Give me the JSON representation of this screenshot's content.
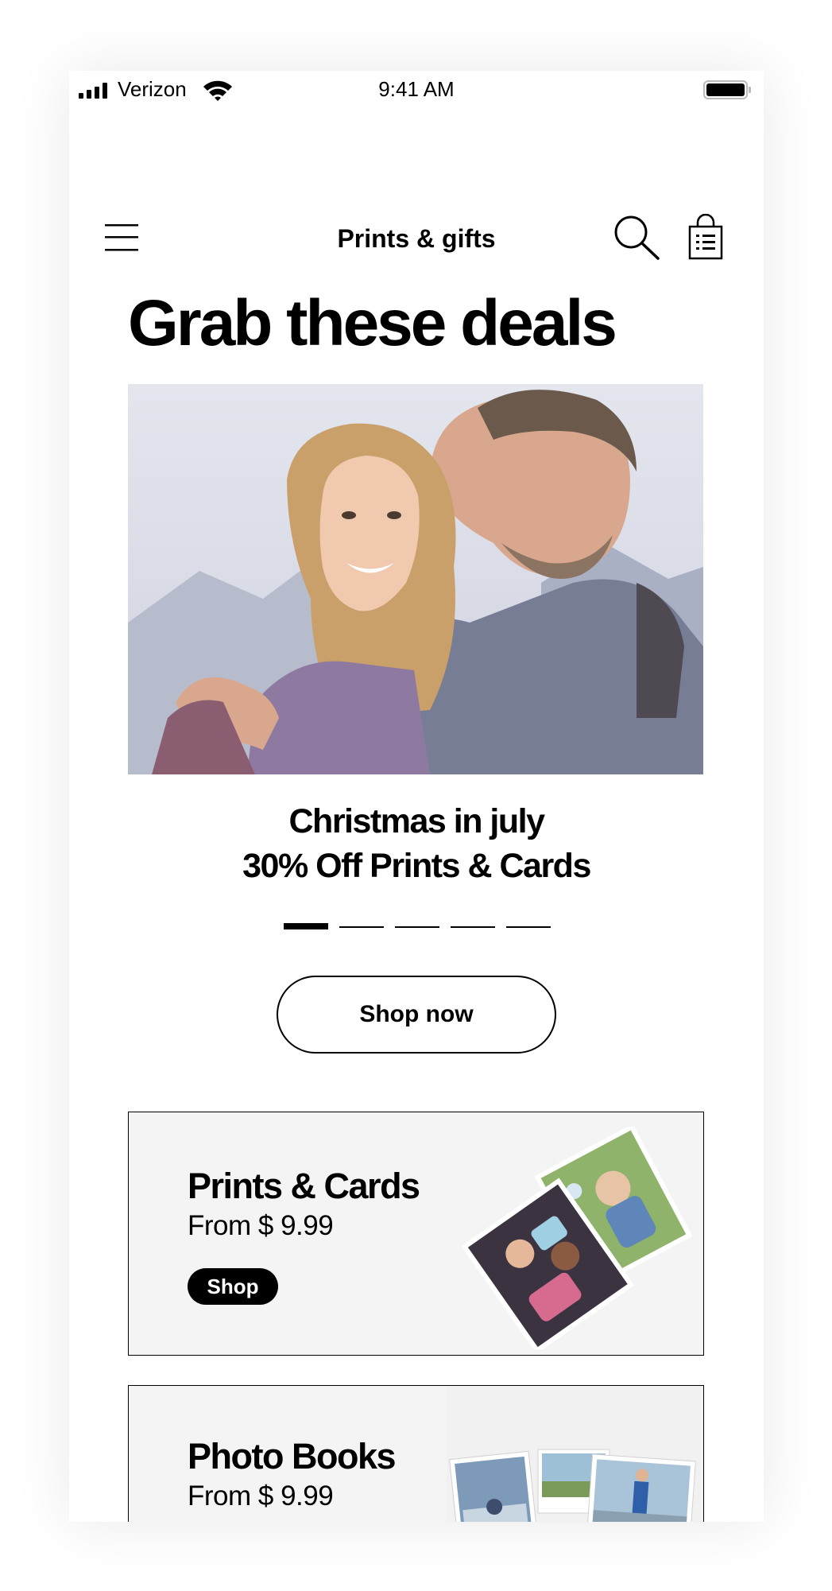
{
  "status_bar": {
    "carrier": "Verizon",
    "time": "9:41 AM"
  },
  "nav": {
    "title": "Prints & gifts",
    "menu_icon": "hamburger-menu-icon",
    "search_icon": "search-icon",
    "bag_icon": "shopping-bag-icon"
  },
  "headline": "Grab these deals",
  "carousel": {
    "promo_line1": "Christmas in july",
    "promo_line2": "30% Off Prints & Cards",
    "slide_count": 5,
    "active_slide": 1,
    "cta_label": "Shop now"
  },
  "products": [
    {
      "title": "Prints & Cards",
      "price": "From $ 9.99",
      "button_label": "Shop"
    },
    {
      "title": "Photo Books",
      "price": "From $ 9.99"
    }
  ]
}
